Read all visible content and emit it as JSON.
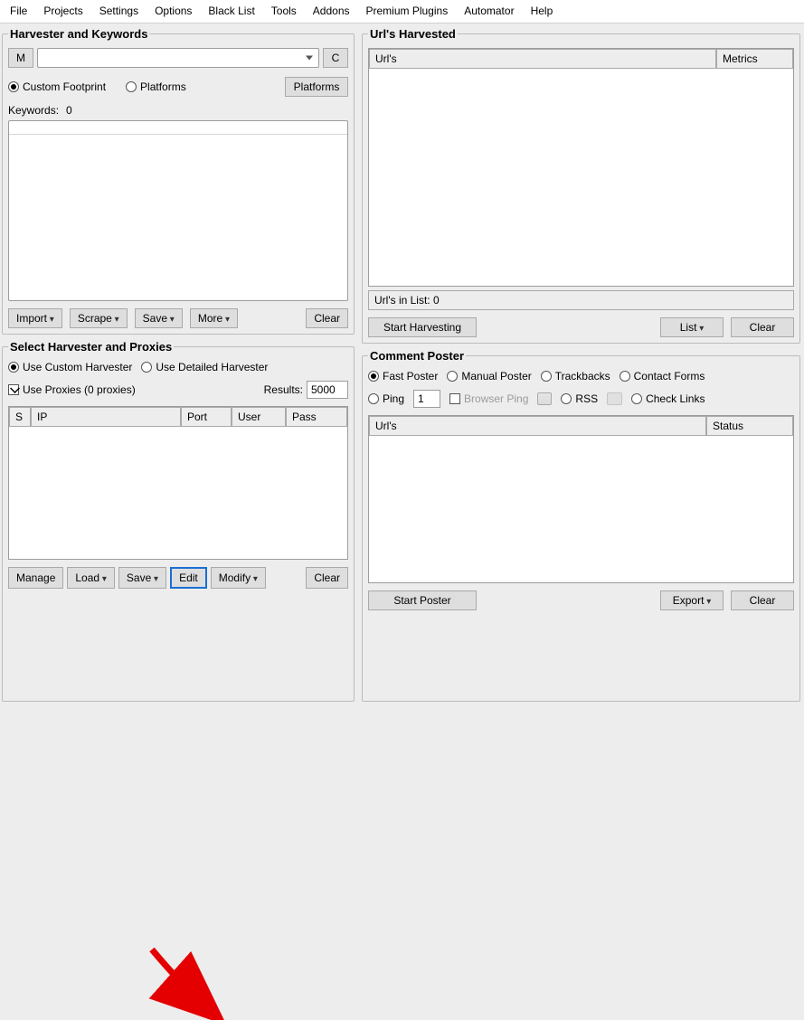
{
  "menu": [
    "File",
    "Projects",
    "Settings",
    "Options",
    "Black List",
    "Tools",
    "Addons",
    "Premium Plugins",
    "Automator",
    "Help"
  ],
  "harvester": {
    "legend": "Harvester and Keywords",
    "m_btn": "M",
    "c_btn": "C",
    "radio_custom": "Custom Footprint",
    "radio_platforms": "Platforms",
    "platforms_btn": "Platforms",
    "keywords_label": "Keywords:",
    "keywords_count": "0",
    "import": "Import",
    "scrape": "Scrape",
    "save": "Save",
    "more": "More",
    "clear": "Clear"
  },
  "select_harvester": {
    "legend": "Select Harvester and Proxies",
    "radio_custom": "Use Custom Harvester",
    "radio_detailed": "Use Detailed Harvester",
    "use_proxies": "Use Proxies  (0 proxies)",
    "results_label": "Results:",
    "results_value": "5000",
    "cols": {
      "s": "S",
      "ip": "IP",
      "port": "Port",
      "user": "User",
      "pass": "Pass"
    },
    "manage": "Manage",
    "load": "Load",
    "save": "Save",
    "edit": "Edit",
    "modify": "Modify",
    "clear": "Clear"
  },
  "urls_harvested": {
    "legend": "Url's Harvested",
    "col_urls": "Url's",
    "col_metrics": "Metrics",
    "status": "Url's in List:  0",
    "start": "Start Harvesting",
    "list": "List",
    "clear": "Clear"
  },
  "poster": {
    "legend": "Comment Poster",
    "fast": "Fast Poster",
    "manual": "Manual Poster",
    "trackbacks": "Trackbacks",
    "contact": "Contact Forms",
    "ping": "Ping",
    "ping_val": "1",
    "browser_ping": "Browser Ping",
    "rss": "RSS",
    "checklinks": "Check Links",
    "col_urls": "Url's",
    "col_status": "Status",
    "start": "Start Poster",
    "export": "Export",
    "clear": "Clear"
  }
}
